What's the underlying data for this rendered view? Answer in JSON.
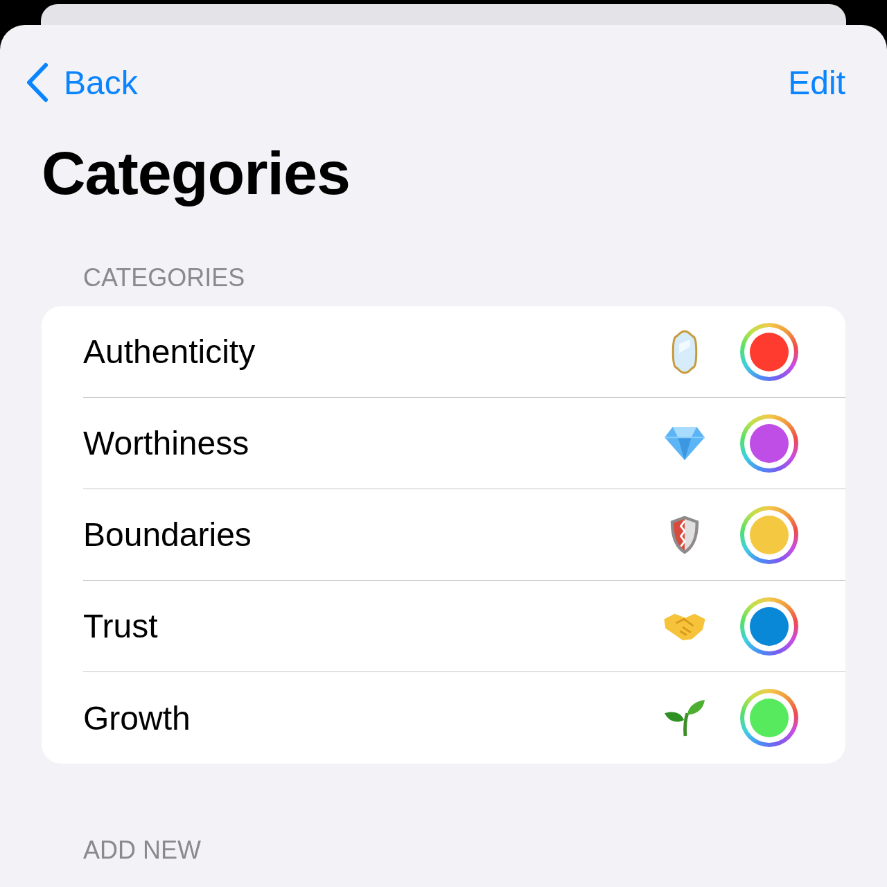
{
  "nav": {
    "back": "Back",
    "edit": "Edit"
  },
  "title": "Categories",
  "sections": [
    {
      "header": "CATEGORIES",
      "rows": [
        {
          "label": "Authenticity",
          "kind": "mirror",
          "color": "#ff3b30"
        },
        {
          "label": "Worthiness",
          "kind": "gem",
          "color": "#bf4ee6"
        },
        {
          "label": "Boundaries",
          "kind": "shield",
          "color": "#f5c842"
        },
        {
          "label": "Trust",
          "kind": "handshake",
          "color": "#0a88d8"
        },
        {
          "label": "Growth",
          "kind": "seedling",
          "color": "#58ea5e"
        }
      ]
    },
    {
      "header": "ADD NEW"
    }
  ]
}
